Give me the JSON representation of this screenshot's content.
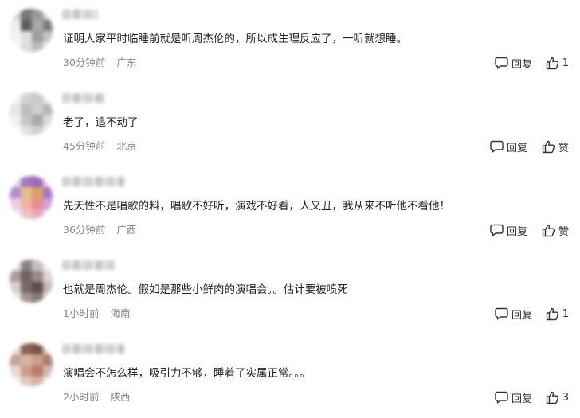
{
  "comments": [
    {
      "content": "证明人家平时临睡前就是听周杰伦的，所以成生理反应了，一听就想睡。",
      "time": "30分钟前",
      "location": "广东",
      "reply_label": "回复",
      "like_label": "1"
    },
    {
      "content": "老了，追不动了",
      "time": "45分钟前",
      "location": "北京",
      "reply_label": "回复",
      "like_label": "赞"
    },
    {
      "content": "先天性不是唱歌的料，唱歌不好听，演戏不好看，人又丑，我从来不听他不看他！",
      "time": "36分钟前",
      "location": "广西",
      "reply_label": "回复",
      "like_label": "赞"
    },
    {
      "content": "也就是周杰伦。假如是那些小鲜肉的演唱会。。估计要被喷死",
      "time": "1小时前",
      "location": "海南",
      "reply_label": "回复",
      "like_label": "1"
    },
    {
      "content": "演唱会不怎么样，吸引力不够，睡着了实属正常。。。",
      "time": "2小时前",
      "location": "陕西",
      "reply_label": "回复",
      "like_label": "3"
    }
  ],
  "colors": {
    "text": "#222222",
    "meta": "#8a8a8a",
    "action": "#333333"
  },
  "icons": {
    "reply": "speech-bubble-icon",
    "like": "thumbs-up-icon"
  }
}
